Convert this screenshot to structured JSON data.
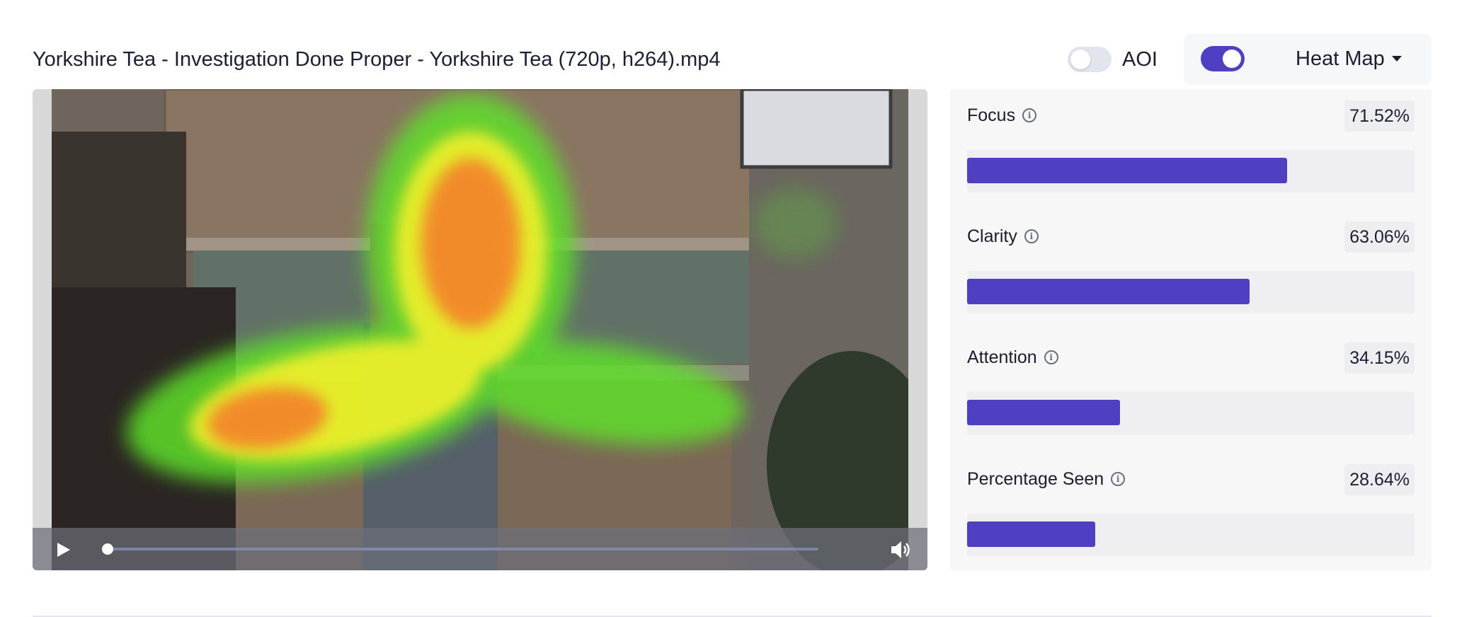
{
  "header": {
    "title": "Yorkshire Tea - Investigation Done Proper - Yorkshire Tea (720p, h264).mp4",
    "aoi_label": "AOI",
    "aoi_enabled": false,
    "heatmap_enabled": true,
    "view_mode": "Heat Map"
  },
  "player": {
    "playing": false,
    "progress": 0.0,
    "play_icon": "play-icon",
    "volume_icon": "volume-icon"
  },
  "metrics": [
    {
      "name": "Focus",
      "value": "71.52%",
      "fraction": 0.7152
    },
    {
      "name": "Clarity",
      "value": "63.06%",
      "fraction": 0.6306
    },
    {
      "name": "Attention",
      "value": "34.15%",
      "fraction": 0.3415
    },
    {
      "name": "Percentage Seen",
      "value": "28.64%",
      "fraction": 0.2864
    }
  ],
  "colors": {
    "accent": "#4f3fc3",
    "heat_low": "#5ee02a",
    "heat_mid": "#f3f02a",
    "heat_high": "#f47a2c"
  }
}
